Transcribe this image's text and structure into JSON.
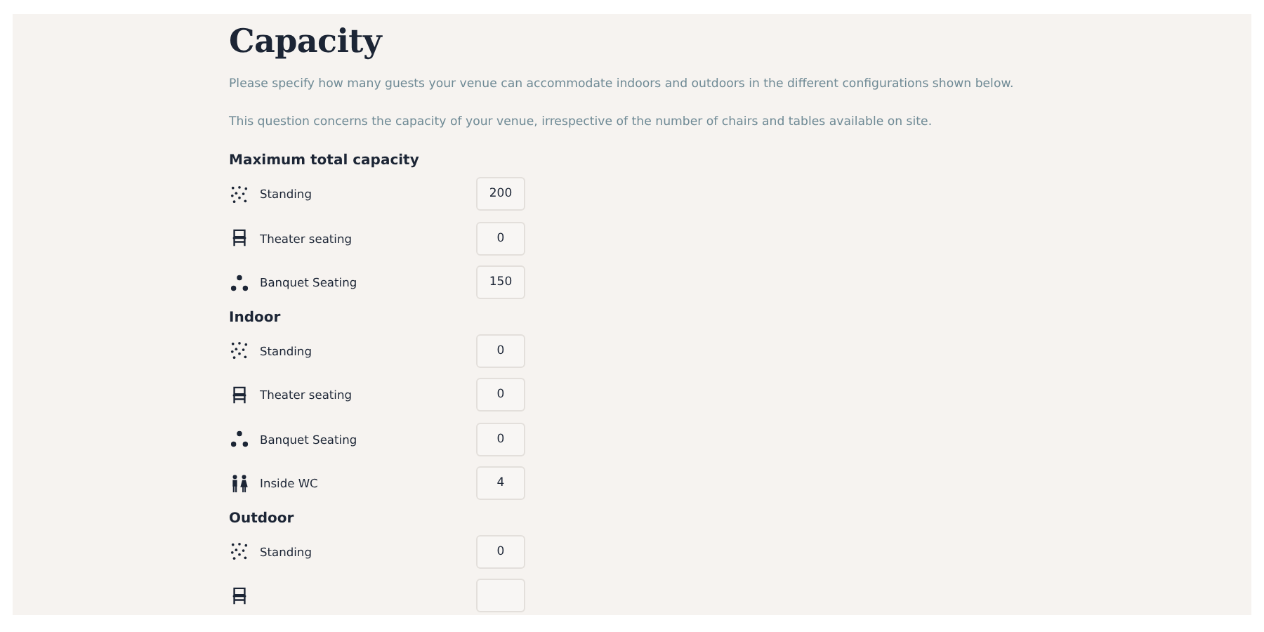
{
  "title": "Capacity",
  "intro": [
    "Please specify how many guests your venue can accommodate indoors and outdoors in the different configurations shown below.",
    "This question concerns the capacity of your venue, irrespective of the number of chairs and tables available on site."
  ],
  "sections": [
    {
      "heading": "Maximum total capacity",
      "rows": [
        {
          "kind": "standing",
          "label": "Standing",
          "value": "200"
        },
        {
          "kind": "theater",
          "label": "Theater seating",
          "value": "0"
        },
        {
          "kind": "banquet",
          "label": "Banquet Seating",
          "value": "150"
        }
      ]
    },
    {
      "heading": "Indoor",
      "rows": [
        {
          "kind": "standing",
          "label": "Standing",
          "value": "0"
        },
        {
          "kind": "theater",
          "label": "Theater seating",
          "value": "0"
        },
        {
          "kind": "banquet",
          "label": "Banquet Seating",
          "value": "0"
        },
        {
          "kind": "wc",
          "label": "Inside WC",
          "value": "4"
        }
      ]
    },
    {
      "heading": "Outdoor",
      "rows": [
        {
          "kind": "standing",
          "label": "Standing",
          "value": "0"
        },
        {
          "kind": "theater"
        }
      ]
    }
  ]
}
